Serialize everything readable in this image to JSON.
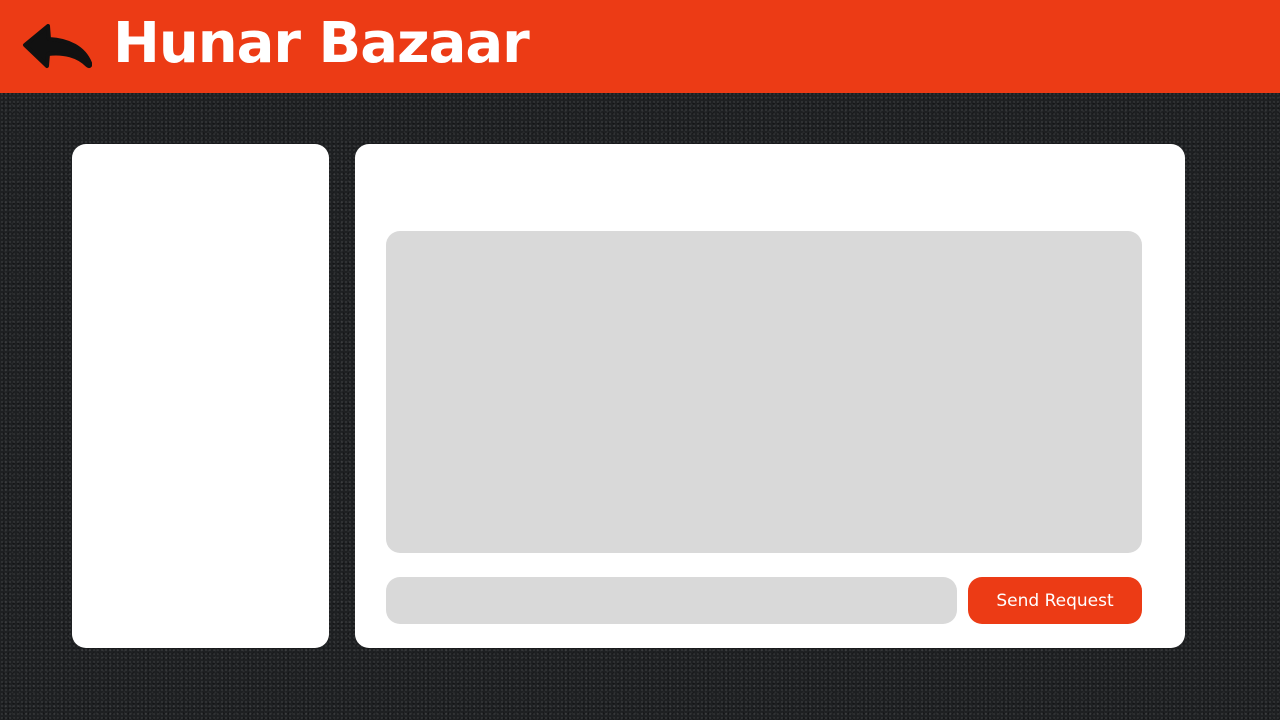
{
  "header": {
    "title": "Hunar Bazaar",
    "back_icon": "back-arrow-icon"
  },
  "main": {
    "request_input": {
      "value": "",
      "placeholder": ""
    },
    "send_button_label": "Send Request"
  },
  "colors": {
    "brand": "#ec3b15",
    "panel": "#ffffff",
    "field": "#d9d9d9",
    "background": "#1e2022"
  }
}
